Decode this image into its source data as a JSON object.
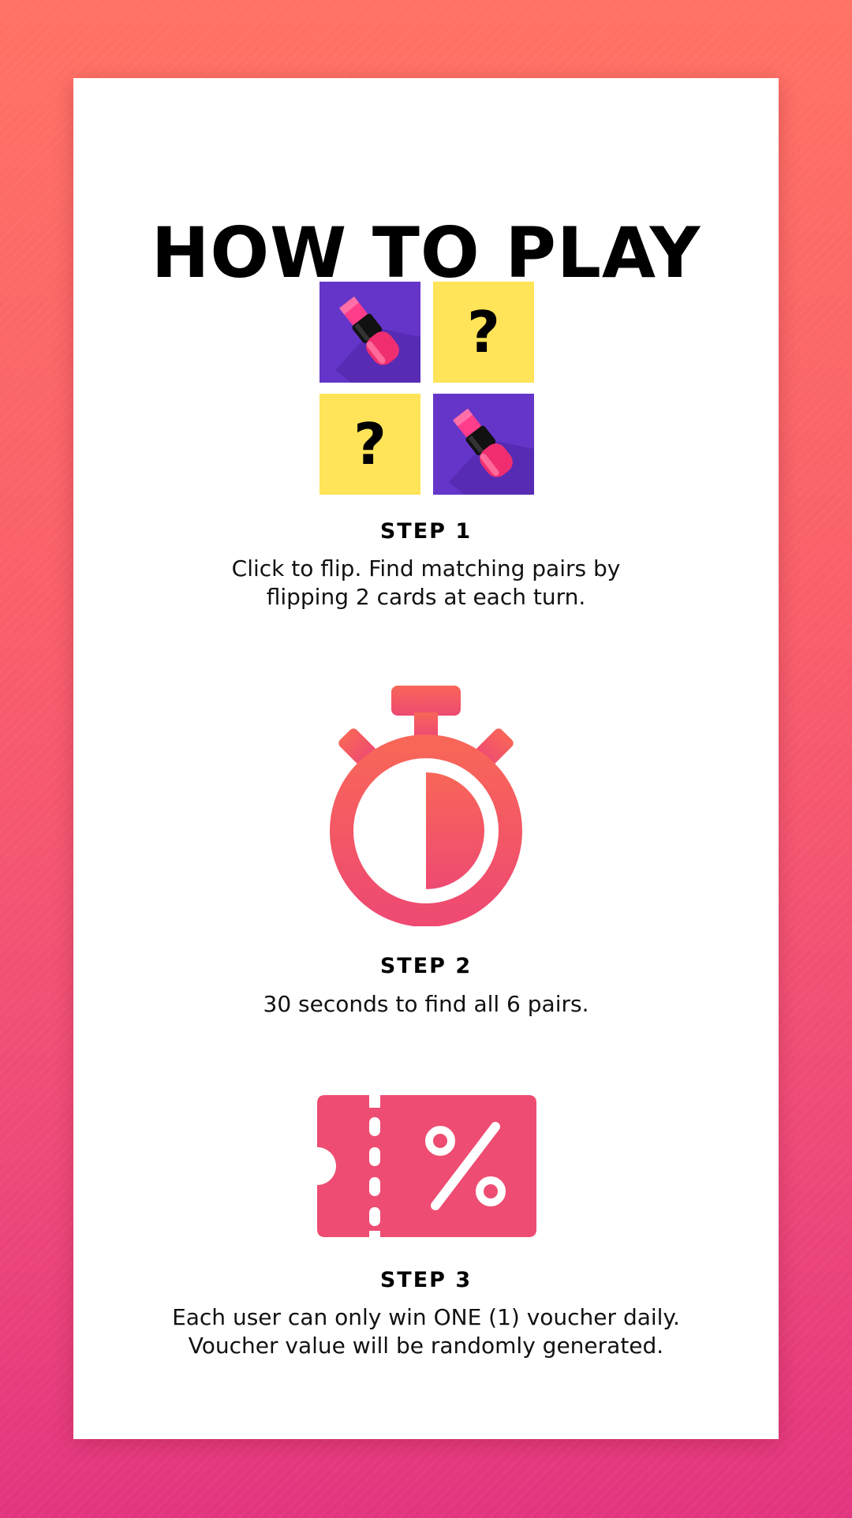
{
  "title": "HOW TO PLAY",
  "colors": {
    "accent": "#f15b6c",
    "tile_purple": "#6535c9",
    "tile_yellow": "#ffe358",
    "lipstick": "#f02e6f"
  },
  "step1": {
    "tiles": [
      {
        "face": "lipstick",
        "icon": "lipstick-icon"
      },
      {
        "face": "?"
      },
      {
        "face": "?"
      },
      {
        "face": "lipstick",
        "icon": "lipstick-icon"
      }
    ],
    "label": "STEP 1",
    "desc_line1": "Click to flip. Find matching pairs by",
    "desc_line2": "flipping 2 cards at each turn."
  },
  "step2": {
    "icon": "stopwatch-icon",
    "label": "STEP 2",
    "desc_line1": "30 seconds to find all 6 pairs."
  },
  "step3": {
    "icon": "voucher-icon",
    "label": "STEP 3",
    "desc_line1": "Each user can only win ONE (1) voucher daily.",
    "desc_line2": "Voucher value will be randomly generated."
  }
}
